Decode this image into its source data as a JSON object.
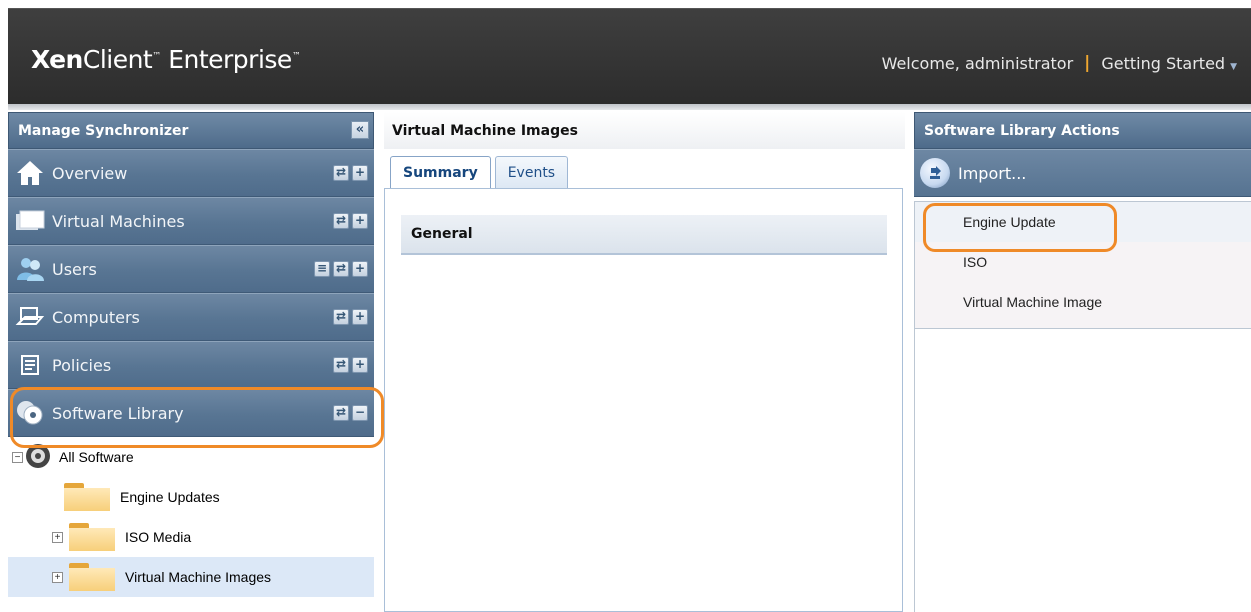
{
  "header": {
    "brand_bold": "Xen",
    "brand_rest": "Client",
    "brand_tail": " Enterprise",
    "welcome": "Welcome, administrator",
    "getting_started": "Getting Started"
  },
  "left_panel": {
    "title": "Manage Synchronizer",
    "collapse_glyph": "«",
    "nav": [
      {
        "label": "Overview",
        "icon": "home-icon"
      },
      {
        "label": "Virtual Machines",
        "icon": "virtual-machines-icon"
      },
      {
        "label": "Users",
        "icon": "users-icon"
      },
      {
        "label": "Computers",
        "icon": "computers-icon"
      },
      {
        "label": "Policies",
        "icon": "policies-icon"
      },
      {
        "label": "Software Library",
        "icon": "software-library-icon"
      }
    ],
    "tree": [
      {
        "label": "All Software",
        "expander": "⊟"
      },
      {
        "label": "Engine Updates"
      },
      {
        "label": "ISO Media",
        "expander": "⊞"
      },
      {
        "label": "Virtual Machine Images",
        "expander": "⊞",
        "selected": true
      }
    ]
  },
  "middle_panel": {
    "title": "Virtual Machine Images",
    "tabs": [
      {
        "label": "Summary",
        "active": true
      },
      {
        "label": "Events",
        "active": false
      }
    ],
    "section": "General"
  },
  "right_panel": {
    "title": "Software Library Actions",
    "import_label": "Import...",
    "menu": [
      {
        "label": "Engine Update",
        "highlighted": true
      },
      {
        "label": "ISO"
      },
      {
        "label": "Virtual Machine Image"
      }
    ]
  },
  "colors": {
    "accent_orange": "#ef8a28",
    "nav_blue": "#587593",
    "header_dark": "#333333"
  }
}
